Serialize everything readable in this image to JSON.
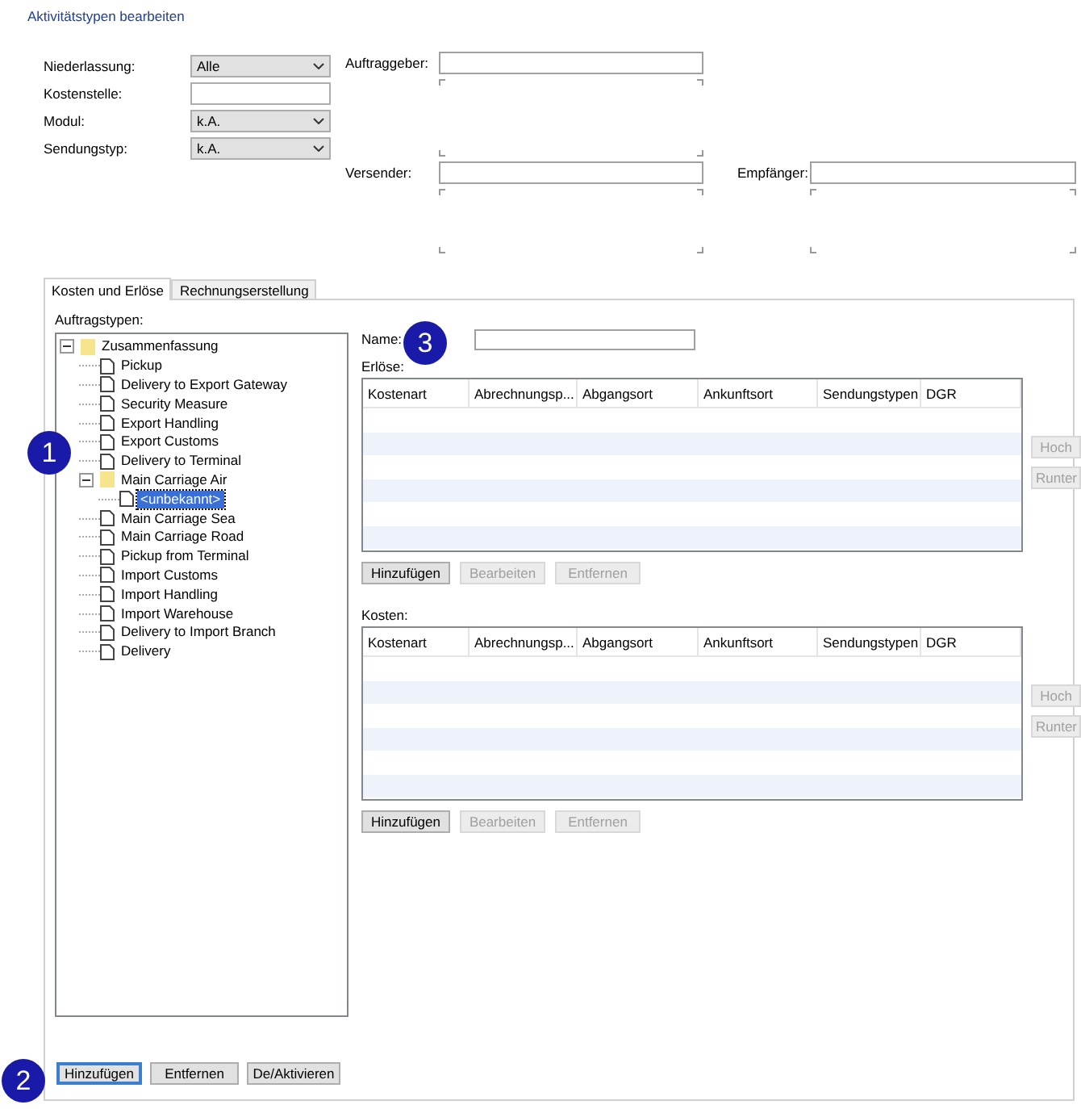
{
  "window": {
    "title": "Aktivitätstypen bearbeiten"
  },
  "filters": [
    {
      "label": "Niederlassung:",
      "kind": "combo",
      "value": "Alle"
    },
    {
      "label": "Kostenstelle:",
      "kind": "text"
    },
    {
      "label": "Modul:",
      "kind": "combo",
      "value": "k.A."
    },
    {
      "label": "Sendungstyp:",
      "kind": "combo",
      "value": "k.A."
    }
  ],
  "parties": [
    {
      "label": "Auftraggeber:"
    },
    {
      "label": "Versender:"
    },
    {
      "label": "Empfänger:"
    }
  ],
  "tabs": [
    {
      "label": "Kosten und Erlöse",
      "selected": true
    },
    {
      "label": "Rechnungserstellung",
      "selected": false
    }
  ],
  "tree": {
    "label": "Auftragstypen:",
    "items": [
      {
        "label": "Zusammenfassung",
        "kind": "folder",
        "expanded": true,
        "selected": false,
        "children": [
          {
            "label": "Pickup",
            "kind": "doc",
            "selected": false
          },
          {
            "label": "Delivery to Export Gateway",
            "kind": "doc",
            "selected": false
          },
          {
            "label": "Security Measure",
            "kind": "doc",
            "selected": false
          },
          {
            "label": "Export Handling",
            "kind": "doc",
            "selected": false
          },
          {
            "label": "Export Customs",
            "kind": "doc",
            "selected": false
          },
          {
            "label": "Delivery to Terminal",
            "kind": "doc",
            "selected": false
          },
          {
            "label": "Main Carriage Air",
            "kind": "folder",
            "expanded": true,
            "selected": false,
            "children": [
              {
                "label": "<unbekannt>",
                "kind": "doc",
                "selected": true
              }
            ]
          },
          {
            "label": "Main Carriage Sea",
            "kind": "doc",
            "selected": false
          },
          {
            "label": "Main Carriage Road",
            "kind": "doc",
            "selected": false
          },
          {
            "label": "Pickup from Terminal",
            "kind": "doc",
            "selected": false
          },
          {
            "label": "Import Customs",
            "kind": "doc",
            "selected": false
          },
          {
            "label": "Import Handling",
            "kind": "doc",
            "selected": false
          },
          {
            "label": "Import Warehouse",
            "kind": "doc",
            "selected": false
          },
          {
            "label": "Delivery to Import Branch",
            "kind": "doc",
            "selected": false
          },
          {
            "label": "Delivery",
            "kind": "doc",
            "selected": false
          }
        ]
      }
    ]
  },
  "tree_buttons": [
    {
      "label": "Hinzufügen",
      "focused": true
    },
    {
      "label": "Entfernen",
      "focused": false
    },
    {
      "label": "De/Aktivieren",
      "focused": false
    }
  ],
  "name_field": {
    "label": "Name:"
  },
  "tables": [
    {
      "label": "Erlöse:",
      "columns": [
        "Kostenart",
        "Abrechnungsp...",
        "Abgangsort",
        "Ankunftsort",
        "Sendungstypen",
        "DGR"
      ],
      "buttons": [
        {
          "label": "Hinzufügen",
          "disabled": false
        },
        {
          "label": "Bearbeiten",
          "disabled": true
        },
        {
          "label": "Entfernen",
          "disabled": true
        }
      ],
      "side_buttons": [
        {
          "label": "Hoch",
          "disabled": true
        },
        {
          "label": "Runter",
          "disabled": true
        }
      ]
    },
    {
      "label": "Kosten:",
      "columns": [
        "Kostenart",
        "Abrechnungsp...",
        "Abgangsort",
        "Ankunftsort",
        "Sendungstypen",
        "DGR"
      ],
      "buttons": [
        {
          "label": "Hinzufügen",
          "disabled": false
        },
        {
          "label": "Bearbeiten",
          "disabled": true
        },
        {
          "label": "Entfernen",
          "disabled": true
        }
      ],
      "side_buttons": [
        {
          "label": "Hoch",
          "disabled": true
        },
        {
          "label": "Runter",
          "disabled": true
        }
      ]
    }
  ],
  "callouts": [
    "1",
    "2",
    "3"
  ]
}
